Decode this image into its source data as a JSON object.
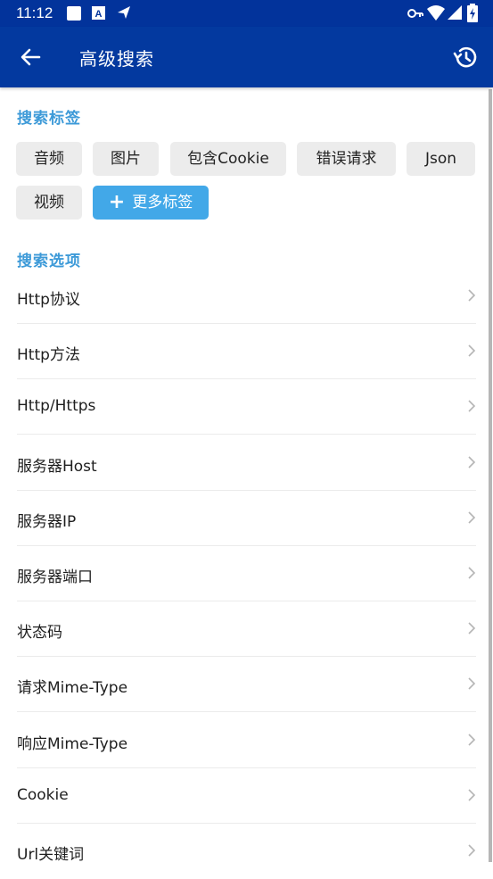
{
  "status_bar": {
    "time": "11:12",
    "left_icons": [
      "square-icon",
      "a-badge-icon",
      "navigation-icon"
    ],
    "right_icons": [
      "key-icon",
      "wifi-icon",
      "signal-icon",
      "battery-charging-icon"
    ]
  },
  "app_bar": {
    "title": "高级搜索",
    "back_icon": "arrow-left-icon",
    "history_icon": "history-icon"
  },
  "tags_section": {
    "title": "搜索标签",
    "tags": [
      "音频",
      "图片",
      "包含Cookie",
      "错误请求",
      "Json",
      "视频"
    ],
    "add_button_label": "更多标签",
    "add_icon": "plus-icon"
  },
  "options_section": {
    "title": "搜索选项",
    "items": [
      "Http协议",
      "Http方法",
      "Http/Https",
      "服务器Host",
      "服务器IP",
      "服务器端口",
      "状态码",
      "请求Mime-Type",
      "响应Mime-Type",
      "Cookie",
      "Url关键词"
    ]
  },
  "colors": {
    "status_bar": "#02339b",
    "app_bar": "#03399f",
    "accent": "#3d9ad8",
    "chip_bg": "#ececec",
    "add_chip_bg": "#42a8e8"
  }
}
